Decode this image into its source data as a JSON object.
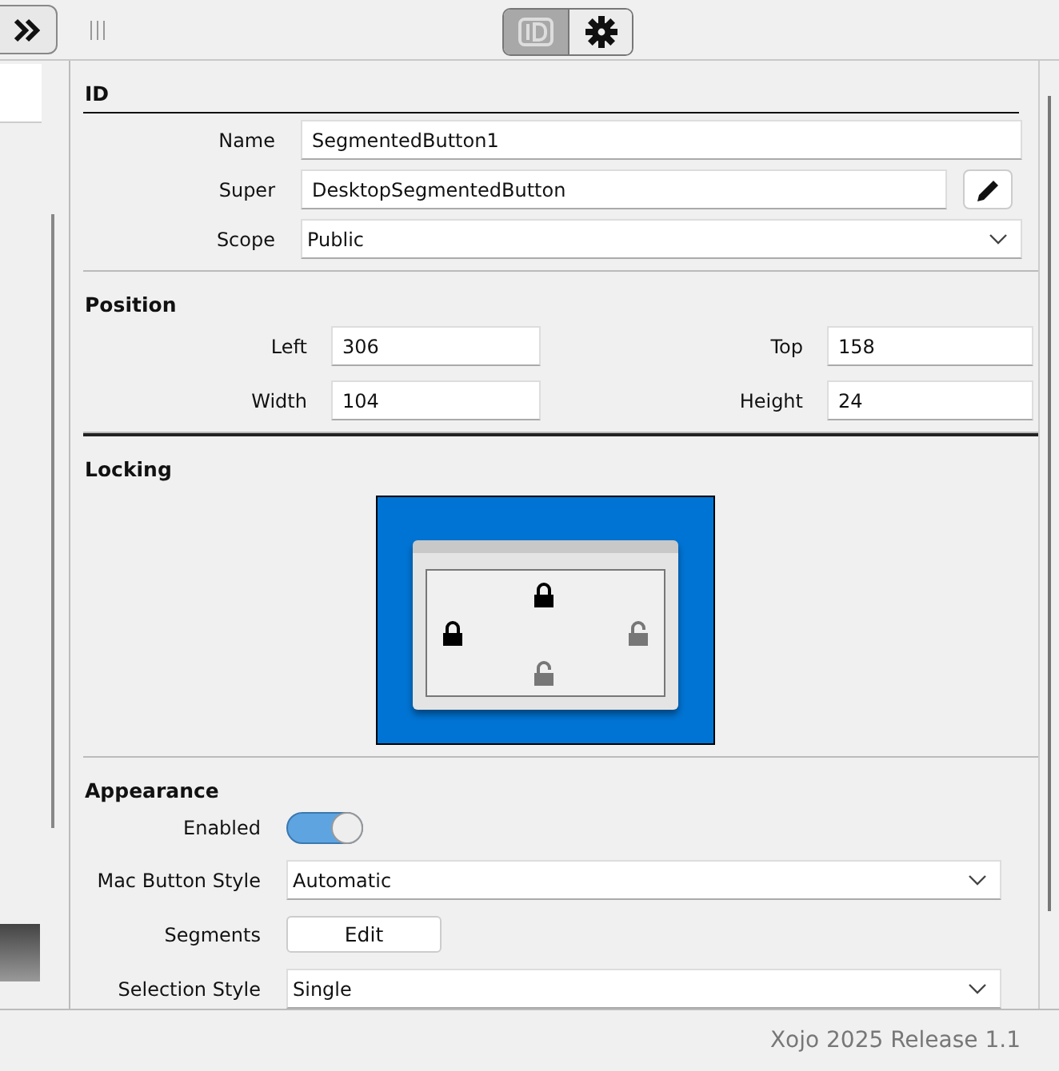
{
  "toolbar": {
    "view_tabs": [
      {
        "kind": "id",
        "selected": true
      },
      {
        "kind": "gear",
        "selected": false
      }
    ]
  },
  "inspector": {
    "sections": [
      {
        "kind": "id",
        "title": "ID",
        "name": {
          "label": "Name",
          "value": "SegmentedButton1"
        },
        "super": {
          "label": "Super",
          "value": "DesktopSegmentedButton"
        },
        "scope": {
          "label": "Scope",
          "value": "Public"
        }
      },
      {
        "kind": "position",
        "title": "Position",
        "fields": [
          {
            "label": "Left",
            "value": "306"
          },
          {
            "label": "Top",
            "value": "158"
          },
          {
            "label": "Width",
            "value": "104"
          },
          {
            "label": "Height",
            "value": "24"
          }
        ]
      },
      {
        "kind": "locking",
        "title": "Locking",
        "locks": {
          "top": {
            "locked": true
          },
          "left": {
            "locked": true
          },
          "right": {
            "locked": false
          },
          "bottom": {
            "locked": false
          }
        }
      },
      {
        "kind": "appearance",
        "title": "Appearance",
        "rows": [
          {
            "kind": "toggle",
            "label": "Enabled",
            "on": true
          },
          {
            "kind": "dropdown",
            "label": "Mac Button Style",
            "value": "Automatic"
          },
          {
            "kind": "button",
            "label": "Segments",
            "button": "Edit"
          },
          {
            "kind": "dropdown",
            "label": "Selection Style",
            "value": "Single"
          }
        ]
      }
    ]
  },
  "status_bar": {
    "text": "Xojo 2025 Release 1.1"
  }
}
